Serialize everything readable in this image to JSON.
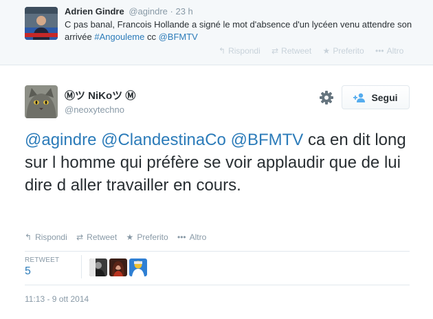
{
  "parent_tweet": {
    "name": "Adrien Gindre",
    "handle": "@agindre",
    "separator": "·",
    "time": "23 h",
    "text_before": "C pas banal, Francois Hollande a signé le mot d'absence d'un lycéen venu attendre son arrivée ",
    "hashtag": "#Angouleme",
    "text_middle": " cc ",
    "mention": "@BFMTV",
    "actions": {
      "reply": "Rispondi",
      "retweet": "Retweet",
      "favorite": "Preferito",
      "more": "Altro"
    }
  },
  "tweet": {
    "name": "Ⓜツ NiKoツ Ⓜ",
    "handle": "@neoxytechno",
    "follow_label": "Segui",
    "mentions": [
      "@agindre",
      "@ClandestinaCo",
      "@BFMTV"
    ],
    "text": " ca en dit long sur l homme qui préfère se voir applaudir que de lui dire d aller travailler en cours.",
    "actions": {
      "reply": "Rispondi",
      "retweet": "Retweet",
      "favorite": "Preferito",
      "more": "Altro"
    },
    "stats": {
      "retweet_label": "RETWEET",
      "retweet_count": "5"
    },
    "timestamp": "11:13 - 9 ott 2014"
  },
  "icons": {
    "reply": "reply-icon",
    "retweet": "retweet-icon",
    "favorite": "star-icon",
    "more": "more-dots-icon",
    "settings": "gear-icon",
    "follow": "add-user-icon"
  },
  "colors": {
    "link": "#2b7bb9",
    "text": "#292f33",
    "muted": "#8899a6",
    "parent_bg": "#f5f8fa",
    "border": "#e1e8ed"
  }
}
